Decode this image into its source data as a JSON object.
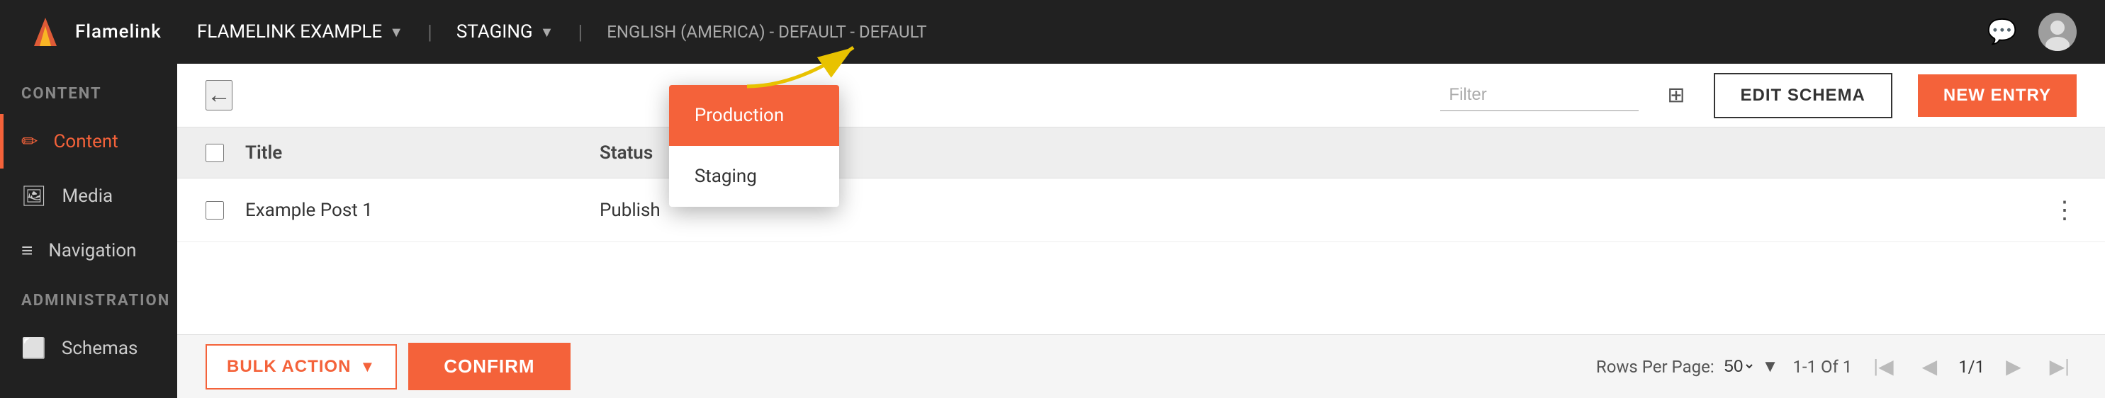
{
  "topnav": {
    "logo_text": "Flamelink",
    "app_name": "FLAMELINK EXAMPLE",
    "env_label": "STAGING",
    "lang_label": "ENGLISH (AMERICA) - DEFAULT - DEFAULT"
  },
  "dropdown": {
    "items": [
      {
        "label": "Production",
        "highlighted": true
      },
      {
        "label": "Staging",
        "highlighted": false
      }
    ]
  },
  "sidebar": {
    "content_section": "CONTENT",
    "items": [
      {
        "label": "Content",
        "icon": "✏",
        "active": true
      },
      {
        "label": "Media",
        "icon": "🖼",
        "active": false
      },
      {
        "label": "Navigation",
        "icon": "≡",
        "active": false
      }
    ],
    "admin_section": "ADMINISTRATION",
    "admin_items": [
      {
        "label": "Schemas",
        "icon": "⬜",
        "active": false
      }
    ]
  },
  "content_header": {
    "back_label": "←",
    "filter_placeholder": "Filter",
    "edit_schema_label": "EDIT SCHEMA",
    "new_entry_label": "NEW ENTRY"
  },
  "table": {
    "col_title": "Title",
    "col_status": "Status",
    "rows": [
      {
        "title": "Example Post 1",
        "status": "Publish"
      }
    ]
  },
  "bottom_bar": {
    "bulk_action_label": "BULK ACTION",
    "confirm_label": "CONFIRM",
    "rows_per_page_label": "Rows Per Page:",
    "rows_per_page_value": "50",
    "range_label": "1-1 Of 1",
    "page_label": "1/1"
  }
}
